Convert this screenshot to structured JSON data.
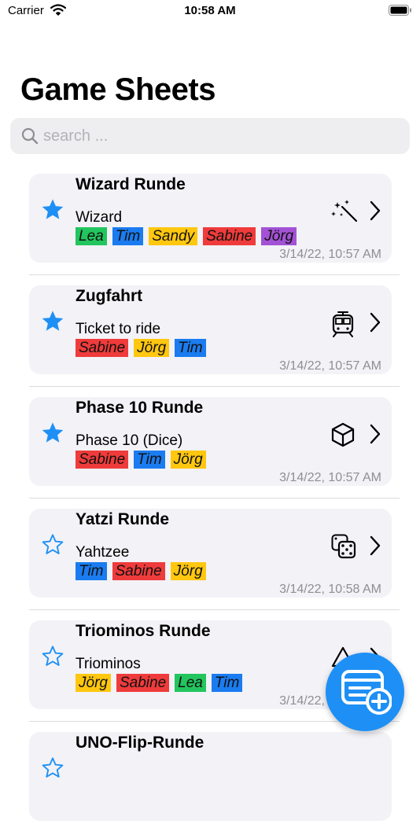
{
  "status": {
    "carrier": "Carrier",
    "time": "10:58 AM"
  },
  "title": "Game Sheets",
  "search": {
    "placeholder": "search ...",
    "value": ""
  },
  "colors": {
    "accent": "#1e90f5",
    "player_colors": {
      "Lea": "#22c55e",
      "Tim": "#1a7cf0",
      "Sandy": "#ffc70f",
      "Sabine": "#ef3b3b",
      "Jörg": "#a352d6"
    }
  },
  "sheets": [
    {
      "title": "Wizard Runde",
      "game": "Wizard",
      "favorite": true,
      "icon": "magic-wand-icon",
      "players": [
        {
          "name": "Lea",
          "color": "#22c55e"
        },
        {
          "name": "Tim",
          "color": "#1a7cf0"
        },
        {
          "name": "Sandy",
          "color": "#ffc70f"
        },
        {
          "name": "Sabine",
          "color": "#ef3b3b"
        },
        {
          "name": "Jörg",
          "color": "#a352d6"
        }
      ],
      "date": "3/14/22, 10:57 AM"
    },
    {
      "title": "Zugfahrt",
      "game": "Ticket to ride",
      "favorite": true,
      "icon": "tram-icon",
      "players": [
        {
          "name": "Sabine",
          "color": "#ef3b3b"
        },
        {
          "name": "Jörg",
          "color": "#ffc70f"
        },
        {
          "name": "Tim",
          "color": "#1a7cf0"
        }
      ],
      "date": "3/14/22, 10:57 AM"
    },
    {
      "title": "Phase 10 Runde",
      "game": "Phase 10 (Dice)",
      "favorite": true,
      "icon": "cube-icon",
      "players": [
        {
          "name": "Sabine",
          "color": "#ef3b3b"
        },
        {
          "name": "Tim",
          "color": "#1a7cf0"
        },
        {
          "name": "Jörg",
          "color": "#ffc70f"
        }
      ],
      "date": "3/14/22, 10:57 AM"
    },
    {
      "title": "Yatzi Runde",
      "game": "Yahtzee",
      "favorite": false,
      "icon": "dice-icon",
      "players": [
        {
          "name": "Tim",
          "color": "#1a7cf0"
        },
        {
          "name": "Sabine",
          "color": "#ef3b3b"
        },
        {
          "name": "Jörg",
          "color": "#ffc70f"
        }
      ],
      "date": "3/14/22, 10:58 AM"
    },
    {
      "title": "Triominos Runde",
      "game": "Triominos",
      "favorite": false,
      "icon": "triangle-icon",
      "players": [
        {
          "name": "Jörg",
          "color": "#ffc70f"
        },
        {
          "name": "Sabine",
          "color": "#ef3b3b"
        },
        {
          "name": "Lea",
          "color": "#22c55e"
        },
        {
          "name": "Tim",
          "color": "#1a7cf0"
        }
      ],
      "date": "3/14/22, 10:58 AM"
    },
    {
      "title": "UNO-Flip-Runde",
      "game": "",
      "favorite": false,
      "icon": "",
      "players": [],
      "date": ""
    }
  ]
}
